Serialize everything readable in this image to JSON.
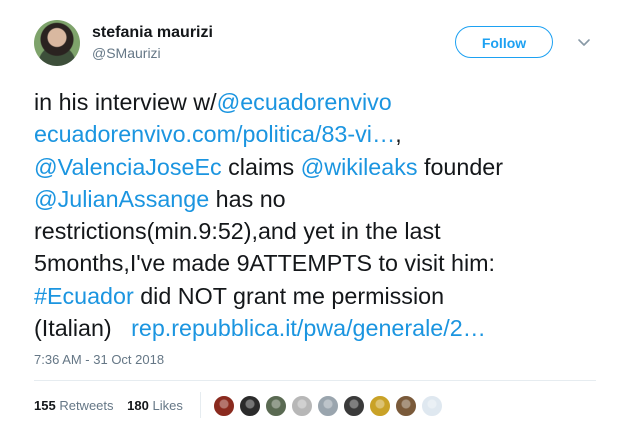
{
  "author": {
    "name": "stefania maurizi",
    "handle": "@SMaurizi"
  },
  "follow_label": "Follow",
  "tweet": {
    "l1_text": "in his interview w/",
    "l1_link": "@ecuadorenvivo",
    "l2_link": "ecuadorenvivo.com/politica/83-vi…",
    "l2_text": ",",
    "l3_link1": "@ValenciaJoseEc",
    "l3_text1": " claims ",
    "l3_link2": "@wikileaks",
    "l3_text2": " founder",
    "l4_link": "@JulianAssange",
    "l4_text": " has no",
    "l5_text": "restrictions(min.9:52),and yet in the last",
    "l6_text": "5months,I've made 9ATTEMPTS to visit him:",
    "l7_link": "#Ecuador",
    "l7_text": " did NOT grant me permission",
    "l8_text": "(Italian)   ",
    "l8_link": "rep.repubblica.it/pwa/generale/2…"
  },
  "timestamp": "7:36 AM - 31 Oct 2018",
  "stats": {
    "retweets_count": "155",
    "retweets_label": "Retweets",
    "likes_count": "180",
    "likes_label": "Likes"
  },
  "likers": [
    {
      "icon": "avatar-1",
      "color": "#8a2a1e"
    },
    {
      "icon": "avatar-2",
      "color": "#2b2b2b"
    },
    {
      "icon": "avatar-3",
      "color": "#5a6a52"
    },
    {
      "icon": "avatar-4",
      "color": "#b7b7b7"
    },
    {
      "icon": "avatar-5",
      "color": "#9aa5ae"
    },
    {
      "icon": "avatar-6",
      "color": "#3a3a3a"
    },
    {
      "icon": "avatar-7",
      "color": "#c9a227"
    },
    {
      "icon": "avatar-8",
      "color": "#7a5a3a"
    },
    {
      "icon": "avatar-9",
      "color": "#dfe8f0"
    }
  ],
  "colors": {
    "link": "#1b95e0",
    "accent": "#1da1f2",
    "secondary_text": "#657786"
  }
}
